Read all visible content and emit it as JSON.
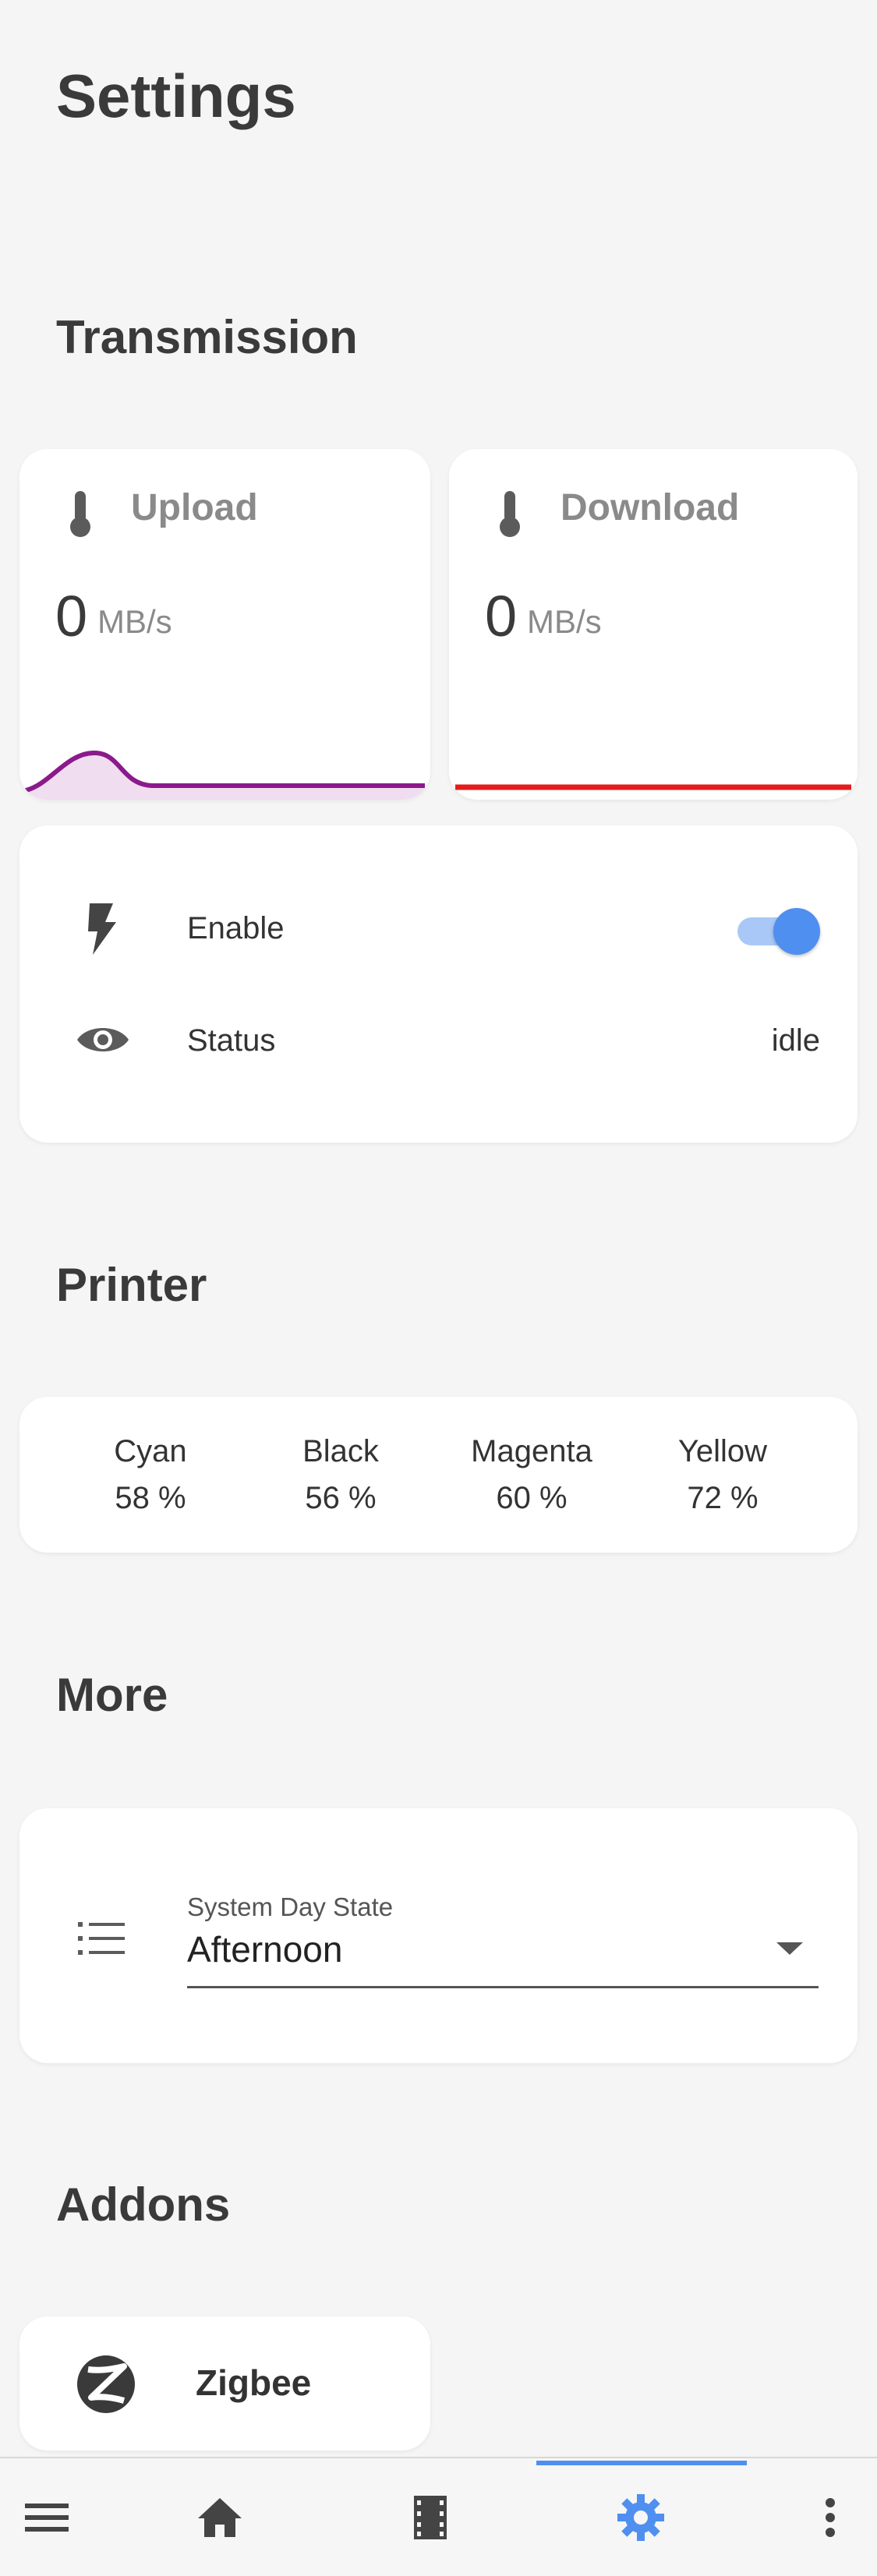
{
  "page": {
    "title": "Settings"
  },
  "sections": {
    "transmission": "Transmission",
    "printer": "Printer",
    "more": "More",
    "addons": "Addons"
  },
  "transmission": {
    "upload": {
      "name": "Upload",
      "value": "0",
      "unit": "MB/s",
      "graph_color": "#8b1a8b"
    },
    "download": {
      "name": "Download",
      "value": "0",
      "unit": "MB/s",
      "graph_color": "#e41c1c"
    },
    "enable": {
      "label": "Enable",
      "on": true,
      "accent": "#4f8ff0"
    },
    "status": {
      "label": "Status",
      "value": "idle"
    }
  },
  "printer": {
    "inks": [
      {
        "name": "Cyan",
        "level": "58 %"
      },
      {
        "name": "Black",
        "level": "56 %"
      },
      {
        "name": "Magenta",
        "level": "60 %"
      },
      {
        "name": "Yellow",
        "level": "72 %"
      }
    ]
  },
  "more": {
    "select_label": "System Day State",
    "select_value": "Afternoon"
  },
  "addons": {
    "items": [
      {
        "name": "Zigbee",
        "icon": "zigbee-icon"
      }
    ]
  },
  "nav": {
    "items": [
      "menu-icon",
      "home-icon",
      "film-icon",
      "gear-icon",
      "more-vert-icon"
    ],
    "active": "gear-icon",
    "accent": "#4f8ff0"
  }
}
